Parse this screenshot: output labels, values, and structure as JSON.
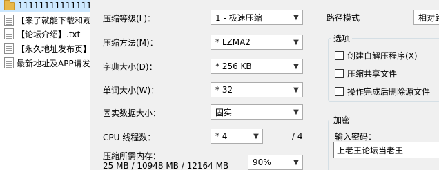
{
  "tree": {
    "items": [
      {
        "label": "111111111111111",
        "icon": "folder-icon",
        "selected": true
      },
      {
        "label": "【来了就能下载和观",
        "icon": "document-icon"
      },
      {
        "label": "【论坛介绍】.txt",
        "icon": "document-icon"
      },
      {
        "label": "【永久地址发布页】",
        "icon": "document-icon"
      },
      {
        "label": "最新地址及APP请发",
        "icon": "document-icon"
      }
    ]
  },
  "settings": {
    "level_label": "压缩等级(L)：",
    "level_value": "1 - 极速压缩",
    "method_label": "压缩方法(M)：",
    "method_value": "* LZMA2",
    "dict_label": "字典大小(D)：",
    "dict_value": "* 256 KB",
    "word_label": "单词大小(W)：",
    "word_value": "* 32",
    "solid_label": "固实数据大小：",
    "solid_value": "固实",
    "threads_label": "CPU 线程数：",
    "threads_value": "* 4",
    "threads_total": "/ 4",
    "memory_label": "压缩所需内存：",
    "memory_value": "25 MB / 10948 MB / 12164 MB",
    "memory_percent": "90%"
  },
  "path_mode": {
    "label": "路径模式",
    "value": "相对路径"
  },
  "options": {
    "title": "选项",
    "items": [
      {
        "label": "创建自解压程序(X)",
        "checked": false
      },
      {
        "label": "压缩共享文件",
        "checked": false
      },
      {
        "label": "操作完成后删除源文件",
        "checked": false
      }
    ]
  },
  "encryption": {
    "title": "加密",
    "password_label": "输入密码：",
    "password_value": "上老王论坛当老王"
  }
}
